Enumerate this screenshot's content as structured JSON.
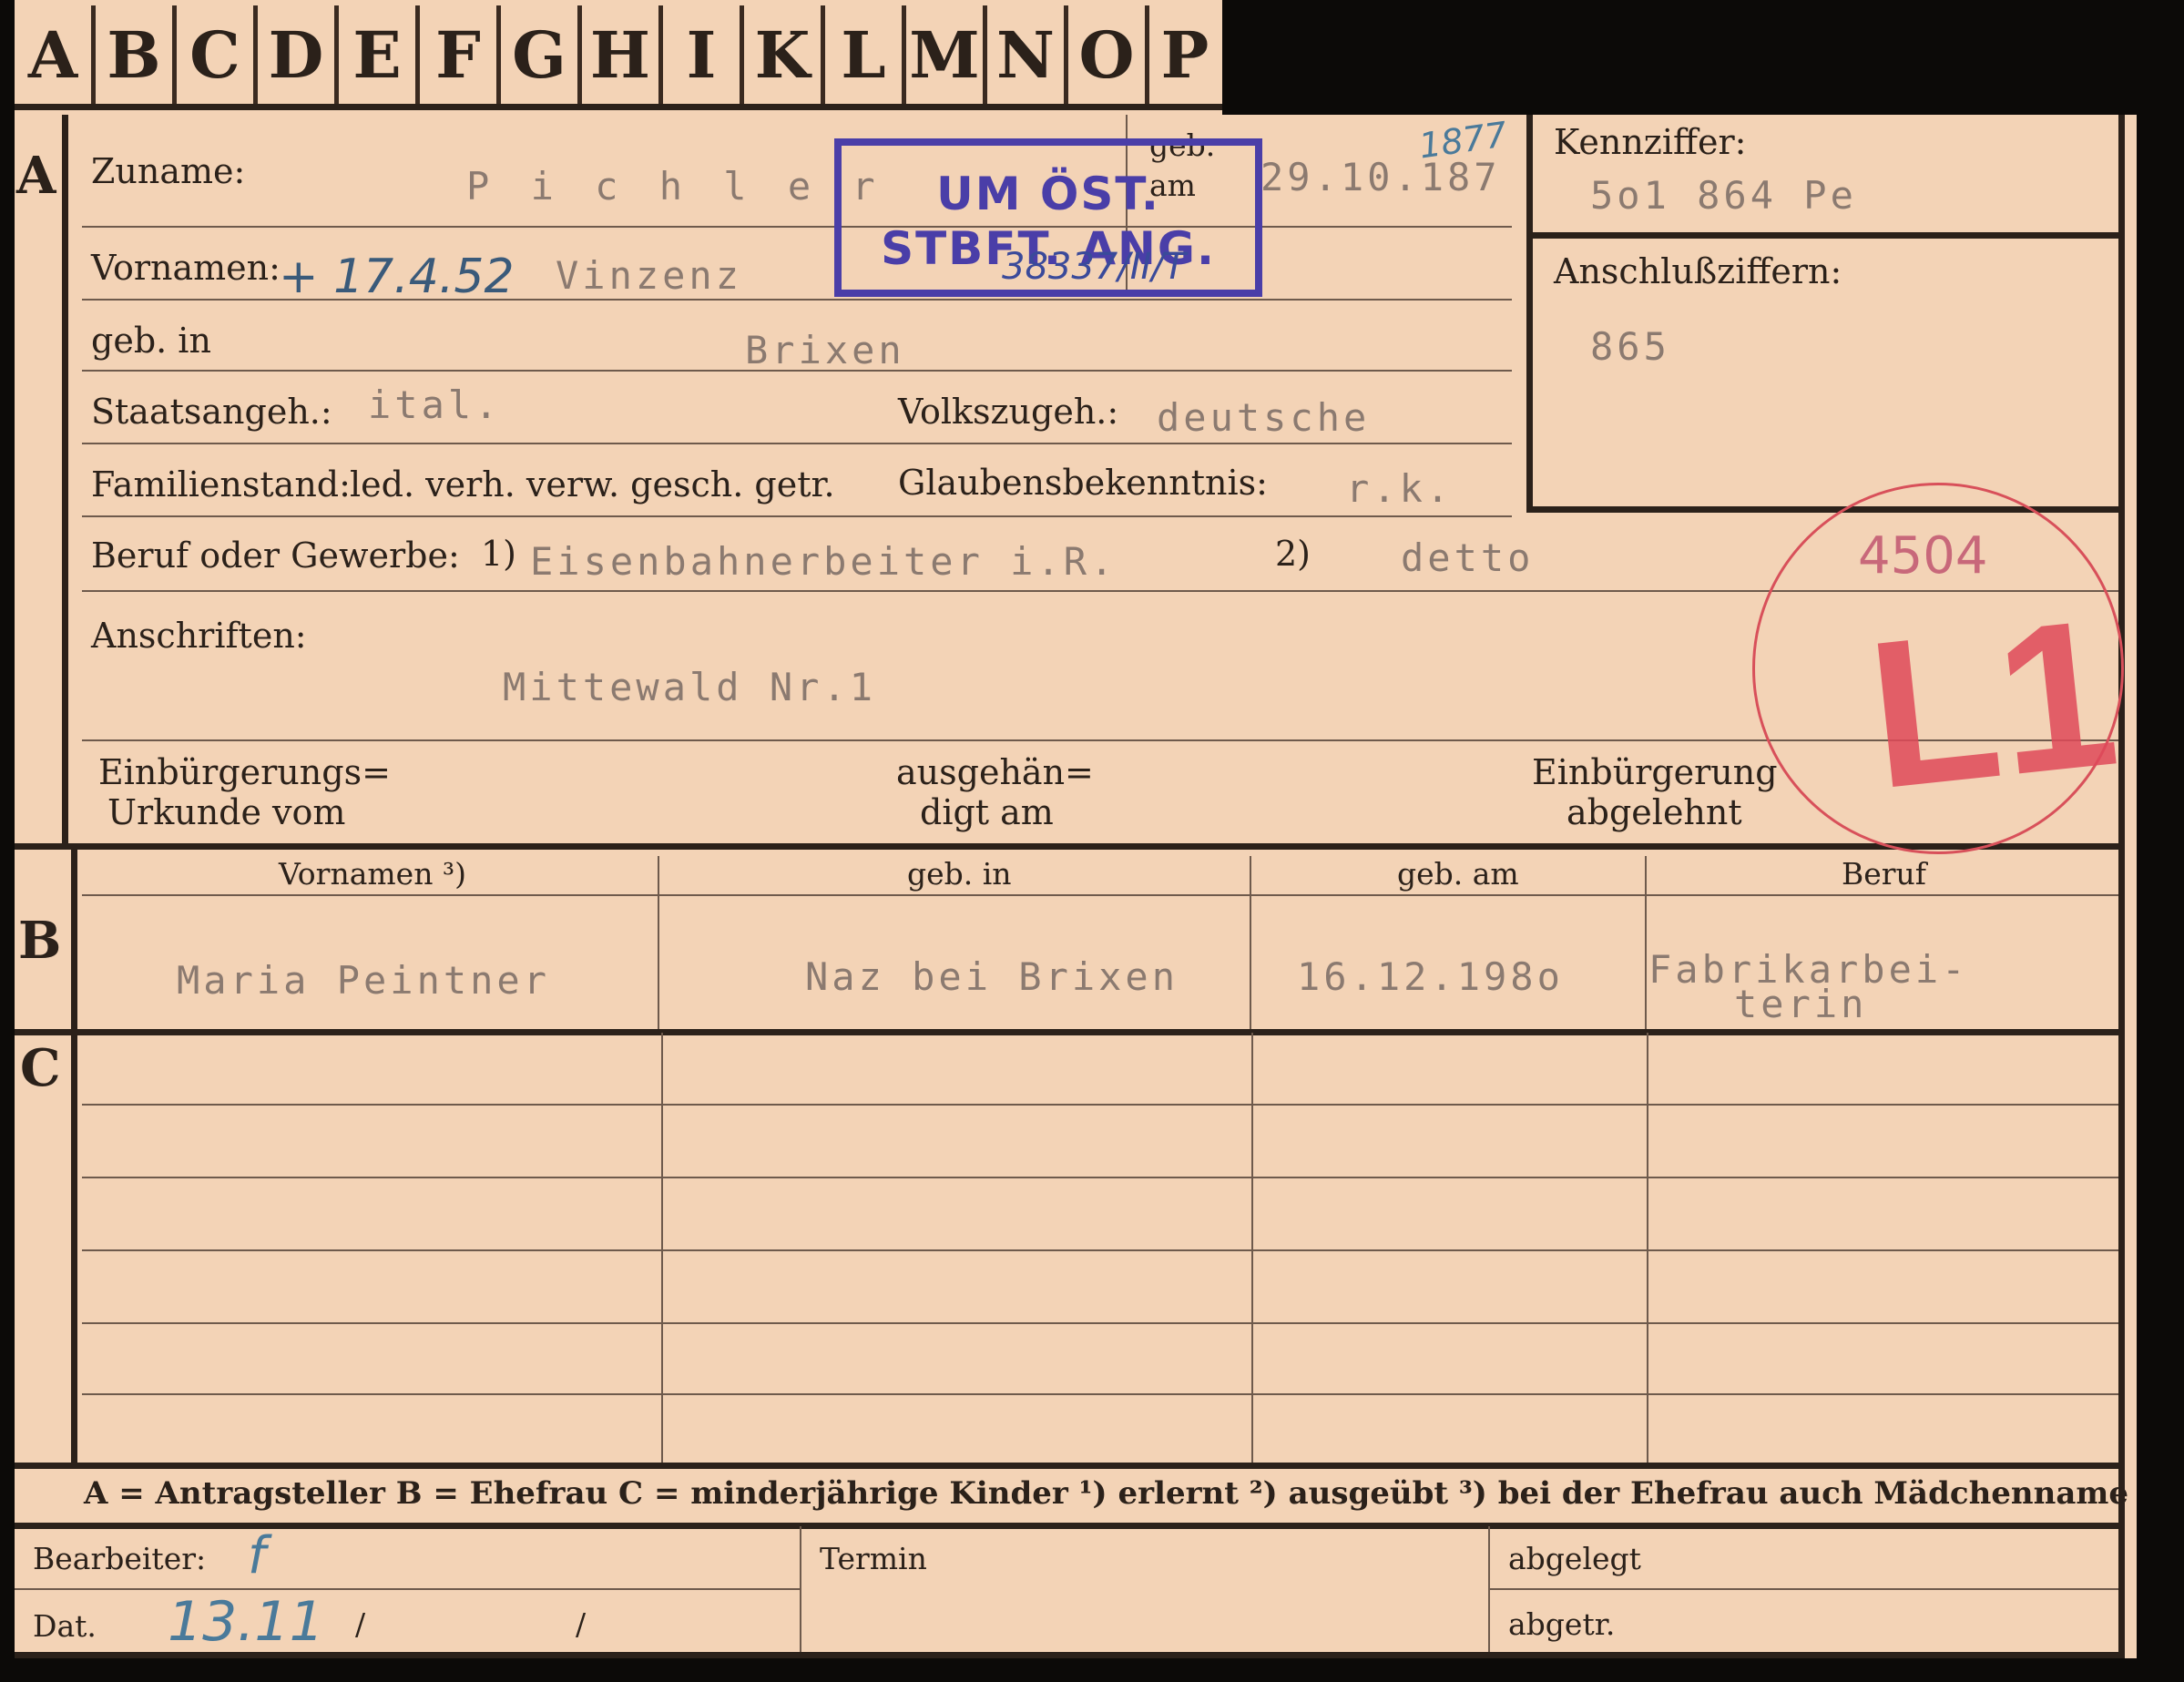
{
  "tabs": [
    "A",
    "B",
    "C",
    "D",
    "E",
    "F",
    "G",
    "H",
    "I",
    "K",
    "L",
    "M",
    "N",
    "O",
    "P"
  ],
  "section_a": {
    "letter": "A",
    "surname_label": "Zuname:",
    "surname_value": "P i c h l e r",
    "born_label_1": "geb.",
    "born_label_2": "am",
    "born_value": "29.10.187",
    "born_year_hand": "1877",
    "first_names_label": "Vornamen:",
    "death_hand": "+ 17.4.52",
    "first_names_value": "Vinzenz",
    "birthplace_label": "geb. in",
    "birthplace_value": "Brixen",
    "citizenship_label": "Staatsangeh.:",
    "citizenship_value": "ital.",
    "ethnicity_label": "Volkszugeh.:",
    "ethnicity_value": "deutsche",
    "marital_label": "Familienstand:",
    "marital_options": "led. verh. verw. gesch. getr.",
    "religion_label": "Glaubensbekenntnis:",
    "religion_value": "r.k.",
    "occupation_label": "Beruf oder Gewerbe:",
    "occ_mark_1": "1)",
    "occupation_value_1": "Eisenbahnerbeiter i.R.",
    "occ_mark_2": "2)",
    "occupation_value_2": "detto",
    "address_label": "Anschriften:",
    "address_value": "Mittewald   Nr.1",
    "naturalization_doc_1": "Einbürgerungs=",
    "naturalization_doc_2": "Urkunde vom",
    "handed_1": "ausgehän=",
    "handed_2": "digt am",
    "rejected_1": "Einbürgerung",
    "rejected_2": "abgelehnt"
  },
  "id_box": {
    "code_label": "Kennziffer:",
    "code_value": "5o1 864  Pe",
    "connect_label": "Anschlußziffern:",
    "connect_value": "865"
  },
  "stamp": {
    "line1": "UM ÖST.",
    "line2": "STBFT. ANG.",
    "hand": "38337/II/T",
    "color": "#4a3ea8"
  },
  "circle_stamp": {
    "number": "4504",
    "code": "L1",
    "color": "#d8505a"
  },
  "section_b": {
    "letter": "B",
    "headers": [
      "Vornamen ³)",
      "geb. in",
      "geb. am",
      "Beruf"
    ],
    "row": [
      "Maria Peintner",
      "Naz bei Brixen",
      "16.12.198o",
      "Fabrikarbei-",
      "terin"
    ]
  },
  "section_c": {
    "letter": "C"
  },
  "legend": "A = Antragsteller   B = Ehefrau   C = minderjährige Kinder   ¹) erlernt   ²) ausgeübt   ³) bei der Ehefrau auch Mädchenname",
  "footer": {
    "clerk_label": "Bearbeiter:",
    "clerk_hand": "f",
    "date_label": "Dat.",
    "date_hand": "13.11",
    "date_slash_1": "/",
    "date_slash_2": "/",
    "term_label": "Termin",
    "filed_label": "abgelegt",
    "taken_label": "abgetr."
  }
}
